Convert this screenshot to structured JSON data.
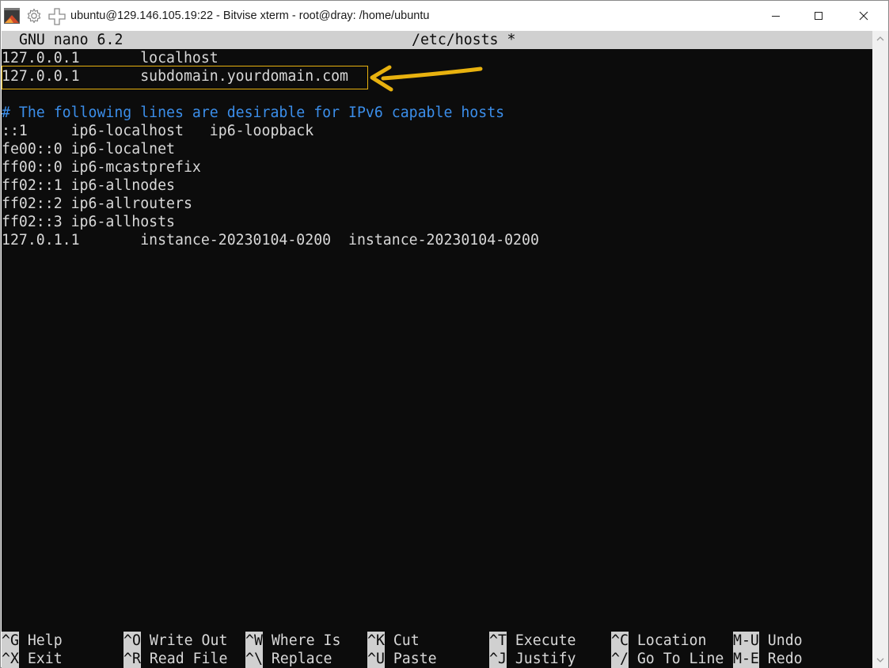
{
  "window": {
    "title": "ubuntu@129.146.105.19:22 - Bitvise xterm - root@dray: /home/ubuntu"
  },
  "icons": {
    "app": "terminal-app-icon",
    "settings": "gear-icon",
    "new_window": "plus-icon",
    "minimize": "minimize-icon",
    "maximize": "maximize-icon",
    "close": "close-icon"
  },
  "colors": {
    "terminal_bg": "#0c0c0c",
    "terminal_fg": "#d8d8d8",
    "comment": "#3b8eea",
    "header_bg": "#d0d0d0",
    "annotation": "#e8b20f"
  },
  "nano": {
    "version_label": "GNU nano 6.2",
    "filename": "/etc/hosts *"
  },
  "file_lines": [
    "127.0.0.1       localhost",
    "127.0.0.1       subdomain.yourdomain.com",
    "",
    "# The following lines are desirable for IPv6 capable hosts",
    "::1     ip6-localhost   ip6-loopback",
    "fe00::0 ip6-localnet",
    "ff00::0 ip6-mcastprefix",
    "ff02::1 ip6-allnodes",
    "ff02::2 ip6-allrouters",
    "ff02::3 ip6-allhosts",
    "127.0.1.1       instance-20230104-0200  instance-20230104-0200"
  ],
  "shortcuts_row1": [
    {
      "key": "^G",
      "label": " Help"
    },
    {
      "key": "^O",
      "label": " Write Out"
    },
    {
      "key": "^W",
      "label": " Where Is"
    },
    {
      "key": "^K",
      "label": " Cut"
    },
    {
      "key": "^T",
      "label": " Execute"
    },
    {
      "key": "^C",
      "label": " Location"
    },
    {
      "key": "M-U",
      "label": " Undo"
    }
  ],
  "shortcuts_row2": [
    {
      "key": "^X",
      "label": " Exit"
    },
    {
      "key": "^R",
      "label": " Read File"
    },
    {
      "key": "^\\",
      "label": " Replace"
    },
    {
      "key": "^U",
      "label": " Paste"
    },
    {
      "key": "^J",
      "label": " Justify"
    },
    {
      "key": "^/",
      "label": " Go To Line"
    },
    {
      "key": "M-E",
      "label": " Redo"
    }
  ]
}
